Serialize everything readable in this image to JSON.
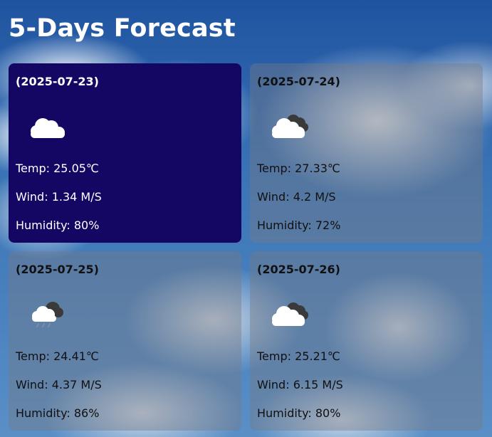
{
  "title": "5-Days Forecast",
  "forecast": [
    {
      "date": "(2025-07-23)",
      "icon": "cloud-icon",
      "temp": "Temp: 25.05℃",
      "wind": "Wind: 1.34 M/S",
      "humidity": "Humidity: 80%",
      "selected": true
    },
    {
      "date": "(2025-07-24)",
      "icon": "broken-clouds-icon",
      "temp": "Temp: 27.33℃",
      "wind": "Wind: 4.2 M/S",
      "humidity": "Humidity: 72%",
      "selected": false
    },
    {
      "date": "(2025-07-25)",
      "icon": "rain-cloud-icon",
      "temp": "Temp: 24.41℃",
      "wind": "Wind: 4.37 M/S",
      "humidity": "Humidity: 86%",
      "selected": false
    },
    {
      "date": "(2025-07-26)",
      "icon": "broken-clouds-icon",
      "temp": "Temp: 25.21℃",
      "wind": "Wind: 6.15 M/S",
      "humidity": "Humidity: 80%",
      "selected": false
    }
  ],
  "colors": {
    "selected_card": "#140763",
    "title_text": "#ffffff"
  }
}
